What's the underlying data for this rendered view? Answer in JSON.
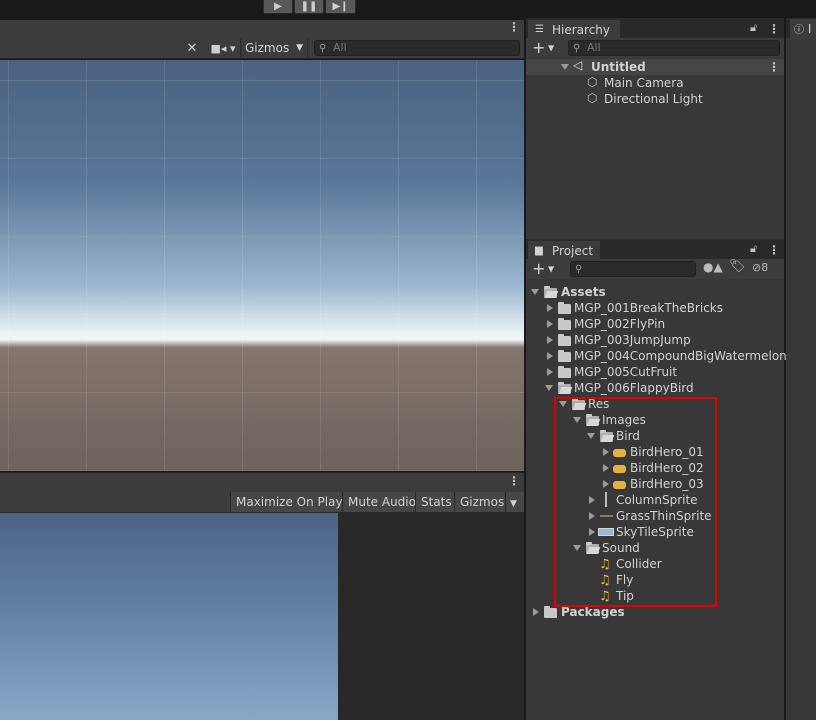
{
  "playbar": {
    "play_icon": "play-icon",
    "pause_icon": "pause-icon",
    "step_icon": "step-icon"
  },
  "scene_view": {
    "gizmos_label": "Gizmos",
    "search_placeholder": "All"
  },
  "game_view": {
    "buttons": [
      "Maximize On Play",
      "Mute Audio",
      "Stats",
      "Gizmos"
    ]
  },
  "hierarchy": {
    "tab_label": "Hierarchy",
    "search_placeholder": "All",
    "scene_name": "Untitled",
    "objects": [
      "Main Camera",
      "Directional Light"
    ]
  },
  "project": {
    "tab_label": "Project",
    "hidden_count": "8",
    "root_assets": "Assets",
    "folders": [
      "MGP_001BreakTheBricks",
      "MGP_002FlyPin",
      "MGP_003JumpJump",
      "MGP_004CompoundBigWatermelon",
      "MGP_005CutFruit",
      "MGP_006FlappyBird"
    ],
    "res": "Res",
    "images": "Images",
    "bird": "Bird",
    "bird_sprites": [
      "BirdHero_01",
      "BirdHero_02",
      "BirdHero_03"
    ],
    "sprites": [
      "ColumnSprite",
      "GrassThinSprite",
      "SkyTileSprite"
    ],
    "sound": "Sound",
    "sounds": [
      "Collider",
      "Fly",
      "Tip"
    ],
    "packages": "Packages"
  },
  "inspector": {
    "tab_label": "I"
  },
  "colors": {
    "highlight_box": "#e00000",
    "accent_audio": "#f2b730"
  }
}
